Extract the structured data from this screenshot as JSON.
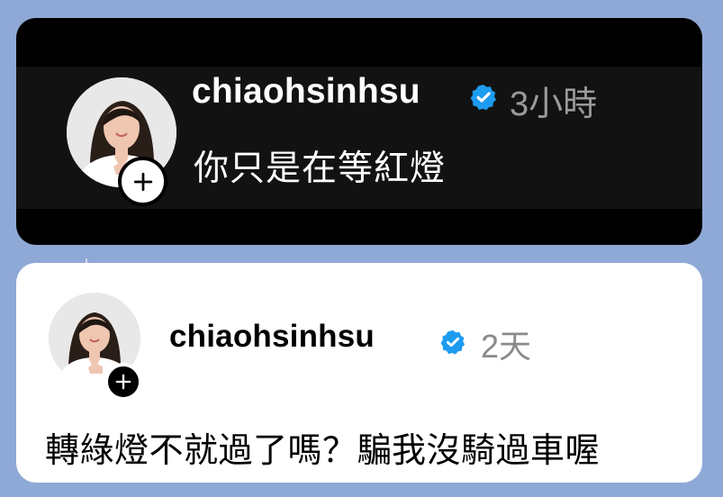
{
  "posts": [
    {
      "username": "chiaohsinhsu",
      "timestamp": "3小時",
      "text": "你只是在等紅燈",
      "theme": "dark"
    },
    {
      "username": "chiaohsinhsu",
      "timestamp": "2天",
      "text": "轉綠燈不就過了嗎？騙我沒騎過車喔",
      "theme": "light"
    }
  ],
  "colors": {
    "page_background": "#8fa9d7",
    "dark_card": "#121212",
    "light_card": "#ffffff",
    "verified_badge": "#1d9bf0",
    "timestamp_gray": "#9a9a9a"
  },
  "icons": {
    "verified": "verified-badge-icon",
    "follow": "plus-icon",
    "avatar": "profile-photo"
  }
}
